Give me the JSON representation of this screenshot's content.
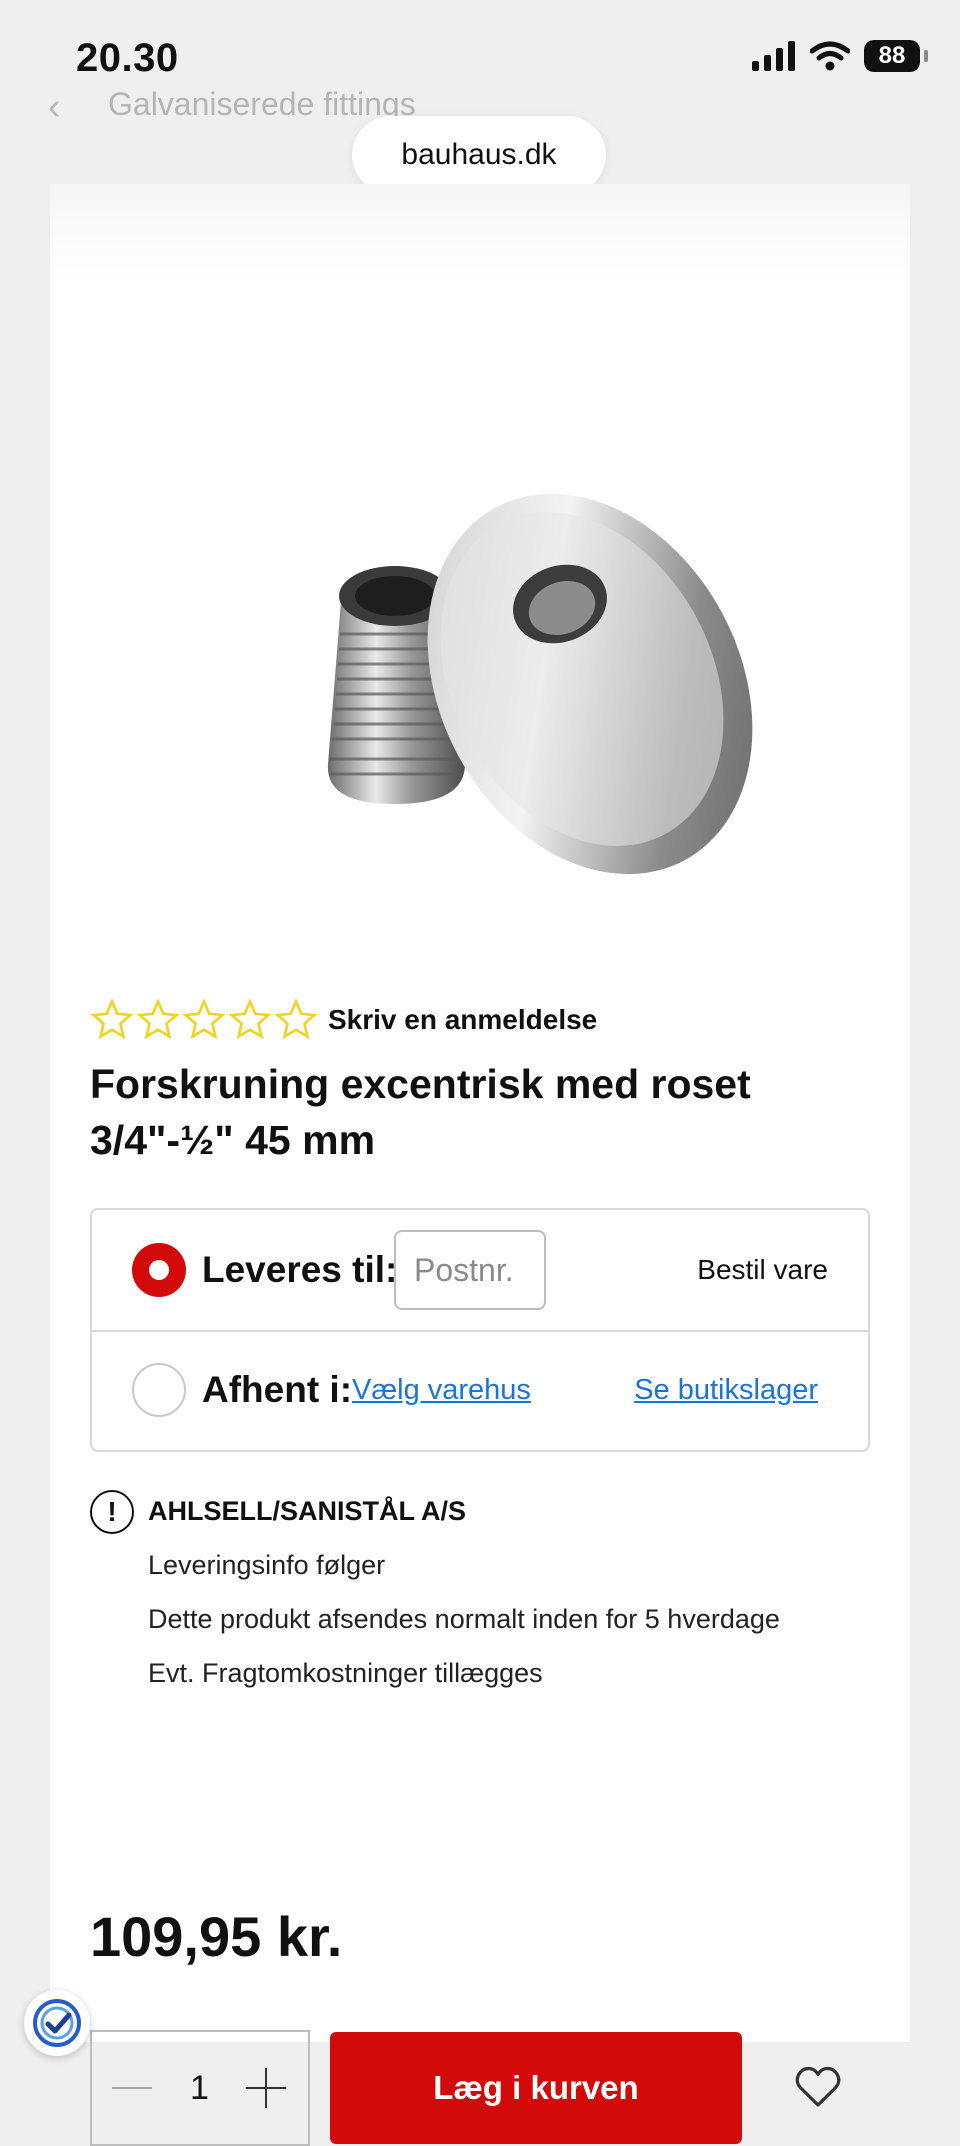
{
  "status_bar": {
    "time": "20.30",
    "battery": "88"
  },
  "nav": {
    "title": "Galvaniserede fittings"
  },
  "url_bar": {
    "domain": "bauhaus.dk"
  },
  "product": {
    "rating_link": "Skriv en anmeldelse",
    "title_line1": "Forskruning excentrisk med roset",
    "title_line2": "3/4\"-½\" 45 mm",
    "price": "109,95 kr."
  },
  "delivery": {
    "delivered_label": "Leveres til:",
    "postcode_placeholder": "Postnr.",
    "order_text": "Bestil vare",
    "pickup_label": "Afhent i:",
    "choose_store_link": "Vælg varehus",
    "stock_link": "Se butikslager"
  },
  "info": {
    "supplier": "AHLSELL/SANISTÅL A/S",
    "lines": [
      "Leveringsinfo følger",
      "Dette produkt afsendes normalt inden for 5 hverdage",
      "Evt. Fragtomkostninger tillægges"
    ]
  },
  "cart": {
    "quantity": "1",
    "add_label": "Læg i kurven"
  },
  "colors": {
    "accent": "#d20a0a",
    "link": "#1a73d9",
    "star": "#f2d31b"
  }
}
